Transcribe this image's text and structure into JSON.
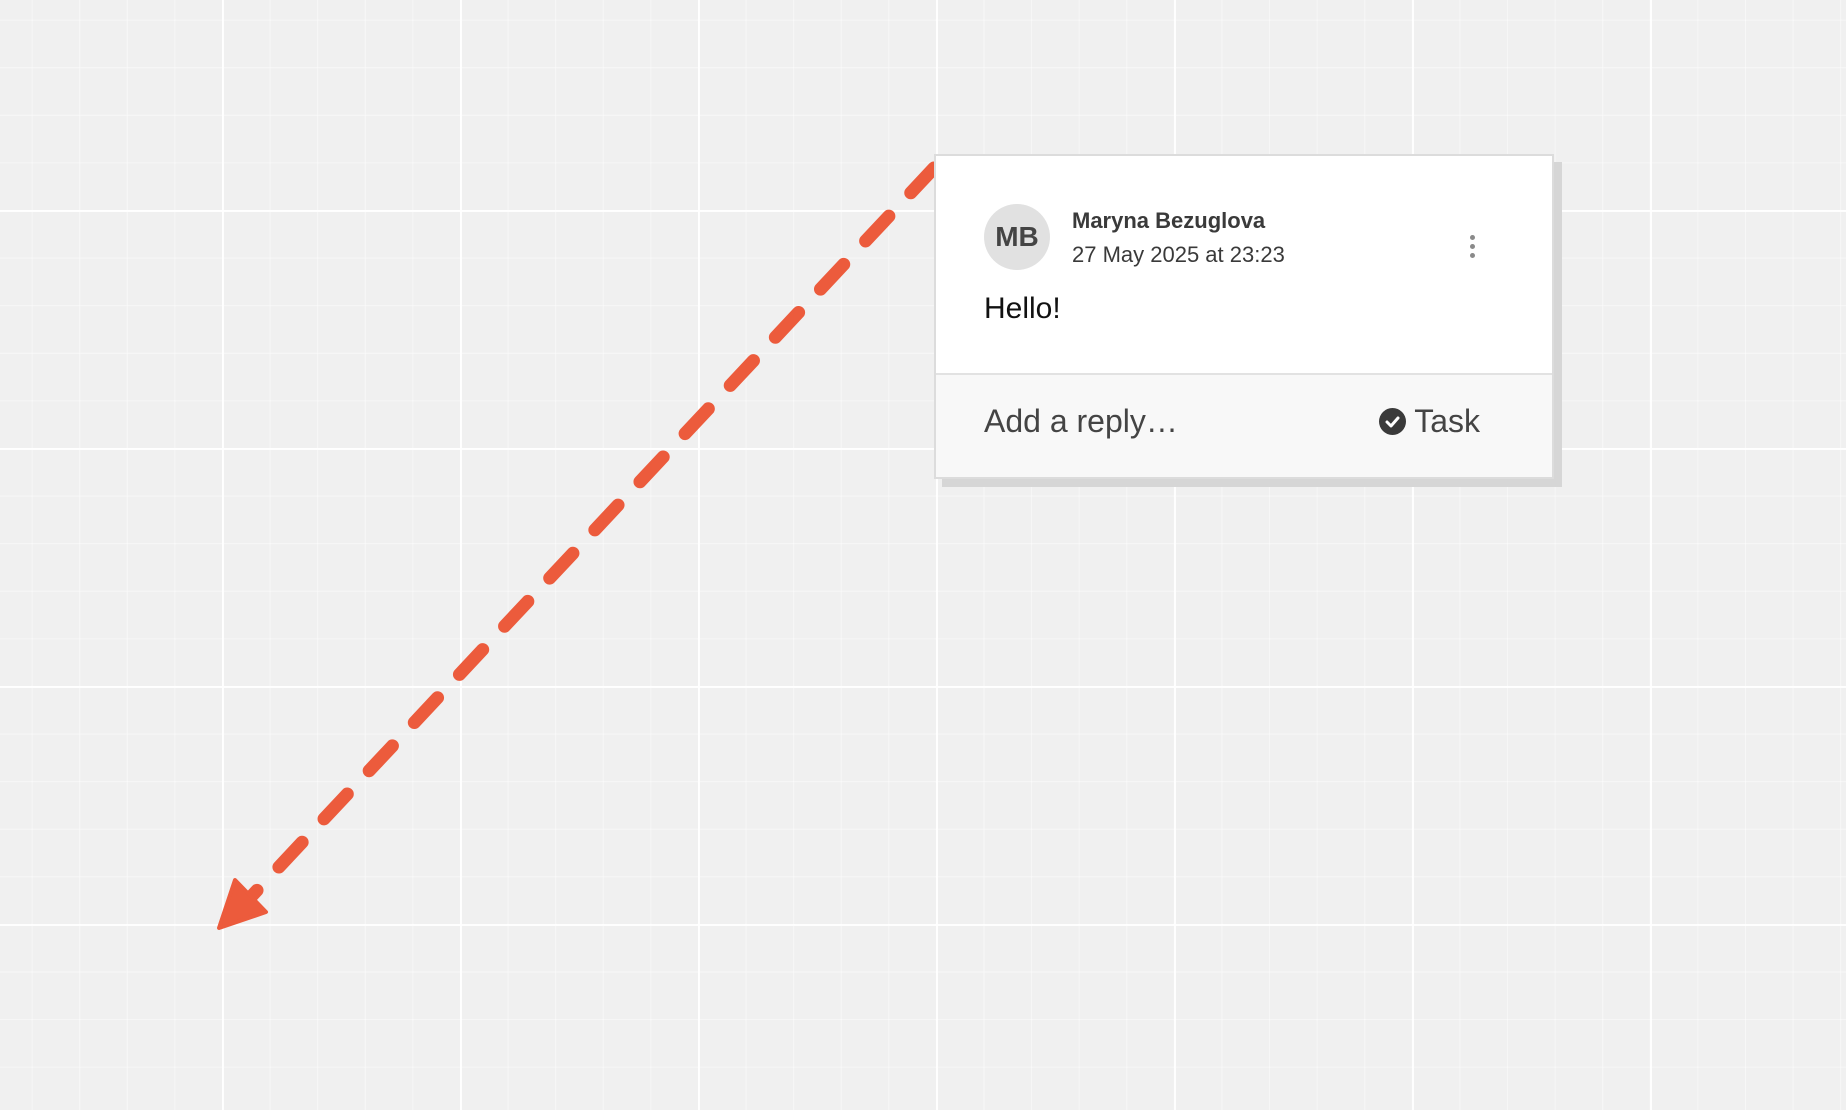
{
  "comment": {
    "avatar_initials": "MB",
    "author": "Maryna Bezuglova",
    "timestamp": "27 May 2025 at 23:23",
    "message": "Hello!",
    "menu_icon": "more-vertical-icon"
  },
  "footer": {
    "reply_placeholder": "Add a reply…",
    "task_label": "Task",
    "task_icon": "check-circle-icon"
  },
  "colors": {
    "connector": "#ec5b3c",
    "canvas_background": "#f0f0f0",
    "card_background": "#ffffff",
    "footer_background": "#f8f8f8"
  }
}
